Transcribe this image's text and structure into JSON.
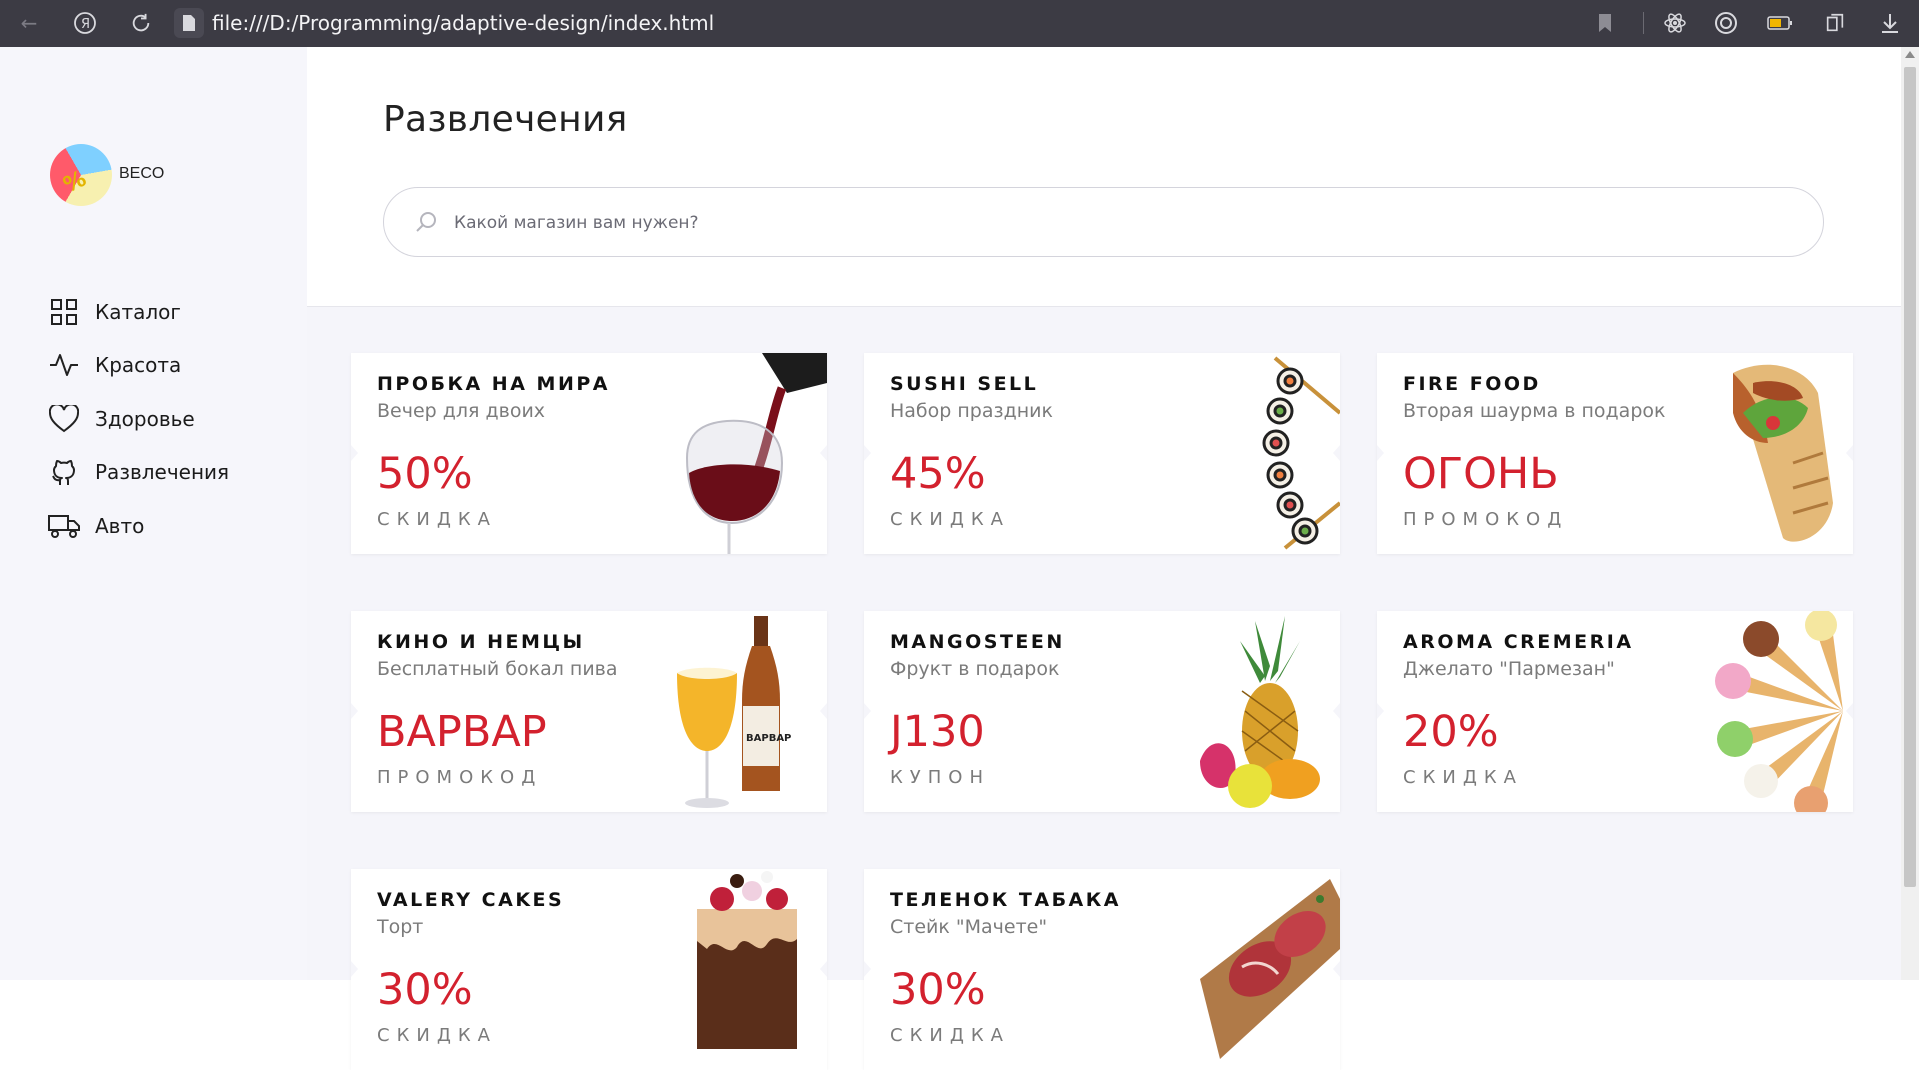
{
  "browser": {
    "url": "file:///D:/Programming/adaptive-design/index.html"
  },
  "sidebar": {
    "brand": "BECO",
    "items": [
      {
        "label": "Каталог",
        "icon": "grid-icon"
      },
      {
        "label": "Красота",
        "icon": "activity-icon"
      },
      {
        "label": "Здоровье",
        "icon": "heart-icon"
      },
      {
        "label": "Развлечения",
        "icon": "github-icon"
      },
      {
        "label": "Авто",
        "icon": "truck-icon"
      }
    ]
  },
  "header": {
    "title": "Развлечения",
    "search_placeholder": "Какой магазин вам нужен?"
  },
  "colors": {
    "accent": "#d3212e",
    "sidebar_bg": "#f6f6fb",
    "browser_bar": "#3c3b44"
  },
  "cards": [
    {
      "title": "ПРОБКА НА МИРА",
      "subtitle": "Вечер для двоих",
      "value": "50%",
      "type": "СКИДКА",
      "image": "wine-glass"
    },
    {
      "title": "SUSHI SELL",
      "subtitle": "Набор праздник",
      "value": "45%",
      "type": "СКИДКА",
      "image": "sushi-rolls"
    },
    {
      "title": "FIRE FOOD",
      "subtitle": "Вторая шаурма в подарок",
      "value": "ОГОНЬ",
      "type": "ПРОМОКОД",
      "image": "shawarma"
    },
    {
      "title": "КИНО И НЕМЦЫ",
      "subtitle": "Бесплатный бокал пива",
      "value": "ВАРВАР",
      "type": "ПРОМОКОД",
      "image": "beer"
    },
    {
      "title": "MANGOSTEEN",
      "subtitle": "Фрукт в подарок",
      "value": "J130",
      "type": "КУПОН",
      "image": "fruits"
    },
    {
      "title": "AROMA CREMERIA",
      "subtitle": "Джелато \"Пармезан\"",
      "value": "20%",
      "type": "СКИДКА",
      "image": "ice-cream-cones"
    },
    {
      "title": "VALERY CAKES",
      "subtitle": "Торт",
      "value": "30%",
      "type": "СКИДКА",
      "image": "cake"
    },
    {
      "title": "ТЕЛЕНОК ТАБАКА",
      "subtitle": "Стейк \"Мачете\"",
      "value": "30%",
      "type": "СКИДКА",
      "image": "steak"
    }
  ]
}
